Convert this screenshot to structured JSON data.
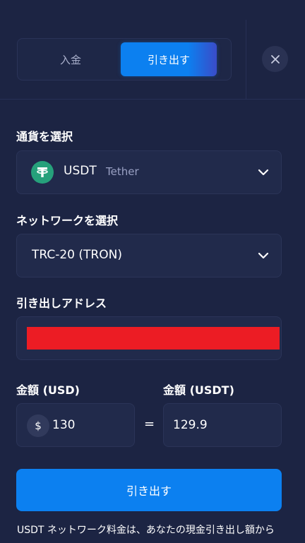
{
  "tabs": {
    "deposit_label": "入金",
    "withdraw_label": "引き出す",
    "active": "withdraw"
  },
  "close_icon": "close-icon",
  "currency": {
    "label": "通貨を選択",
    "code": "USDT",
    "name": "Tether",
    "logo_symbol": "T",
    "logo_color": "#26a17b"
  },
  "network": {
    "label": "ネットワークを選択",
    "value": "TRC-20 (TRON)"
  },
  "address": {
    "label": "引き出しアドレス",
    "redaction_color": "#ec1c24"
  },
  "amount_usd": {
    "label": "金額 (USD)",
    "currency_symbol": "$",
    "value": "130"
  },
  "equals_sign": "=",
  "amount_usdt": {
    "label": "金額 (USDT)",
    "value": "129.9"
  },
  "submit_label": "引き出す",
  "footnote": "USDT ネットワーク料金は、あなたの現金引き出し額から",
  "colors": {
    "background": "#1c2443",
    "field": "#212a4b",
    "accent": "#0c80f0"
  }
}
